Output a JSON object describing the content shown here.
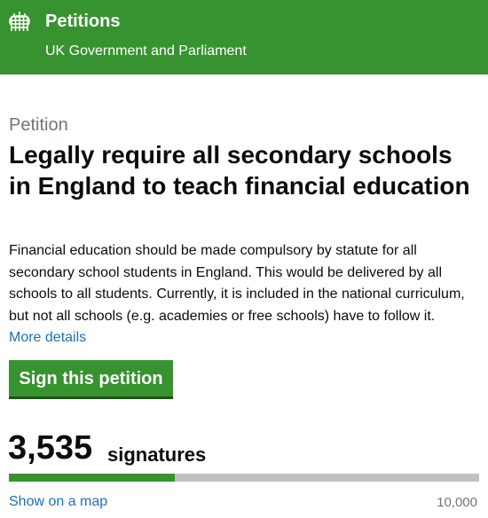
{
  "header": {
    "title": "Petitions",
    "subtitle": "UK Government and Parliament",
    "logo_icon": "portcullis-icon",
    "background_color": "#37932f"
  },
  "petition": {
    "eyebrow": "Petition",
    "title": "Legally require all secondary schools in England to teach financial education",
    "description": "Financial education should be made compulsory by statute for all secondary school students in England. This would be delivered by all schools to all students. Currently, it is included in the national curriculum, but not all schools (e.g. academies or free schools) have to follow it.",
    "more_details_label": "More details",
    "sign_button_label": "Sign this petition"
  },
  "signatures": {
    "count": "3,535",
    "label": "signatures",
    "progress_fraction": 0.3535,
    "map_link_label": "Show on a map",
    "target": "10,000"
  },
  "colors": {
    "brand_green": "#37932f",
    "link_blue": "#1d70b8",
    "muted_grey": "#6f777b",
    "progress_track": "#bfc1c3"
  }
}
